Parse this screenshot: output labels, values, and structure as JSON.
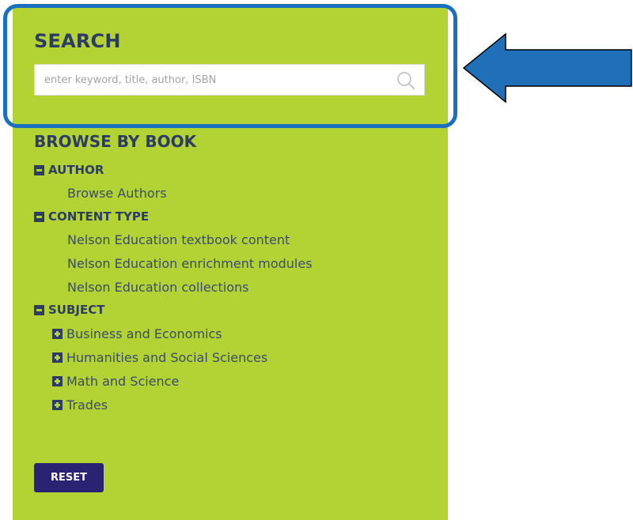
{
  "search": {
    "title": "SEARCH",
    "placeholder": "enter keyword, title, author, ISBN",
    "value": "",
    "icon": "search-icon"
  },
  "browse": {
    "title": "BROWSE BY BOOK",
    "sections": {
      "author": {
        "label": "AUTHOR",
        "expanded": true,
        "items": [
          "Browse Authors"
        ]
      },
      "content_type": {
        "label": "CONTENT TYPE",
        "expanded": true,
        "items": [
          "Nelson Education textbook content",
          "Nelson Education enrichment modules",
          "Nelson Education collections"
        ]
      },
      "subject": {
        "label": "SUBJECT",
        "expanded": true,
        "items": [
          "Business and Economics",
          "Humanities and Social Sciences",
          "Math and Science",
          "Trades"
        ]
      }
    }
  },
  "reset": {
    "label": "RESET"
  },
  "colors": {
    "panel": "#b3d335",
    "heading": "#2e3c62",
    "link": "#3c4a6c",
    "button": "#2a2273",
    "highlight": "#1b6fbf"
  },
  "annotation": {
    "highlight_target": "search",
    "pointer_icon": "arrow-left-icon"
  }
}
